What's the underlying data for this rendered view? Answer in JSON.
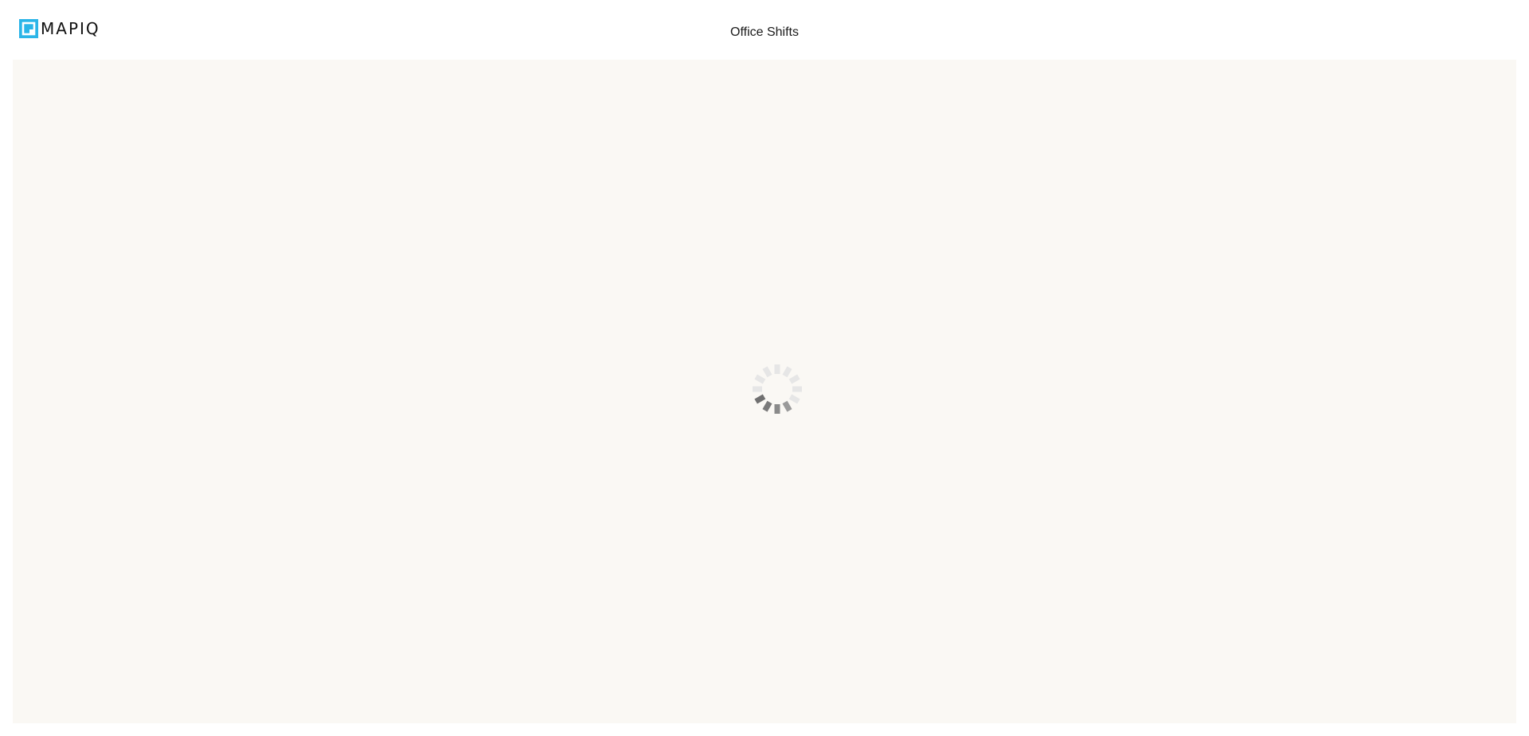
{
  "header": {
    "logo_text": "MAPIQ",
    "logo_icon": "mapiq-q-logo-icon",
    "title": "Office Shifts"
  },
  "colors": {
    "brand": "#2bb5e8",
    "content_background": "#faf8f4",
    "spinner_dark": "#808080",
    "spinner_light": "#e6e6e6"
  },
  "main": {
    "state": "loading",
    "spinner_icon": "loading-spinner-icon"
  }
}
